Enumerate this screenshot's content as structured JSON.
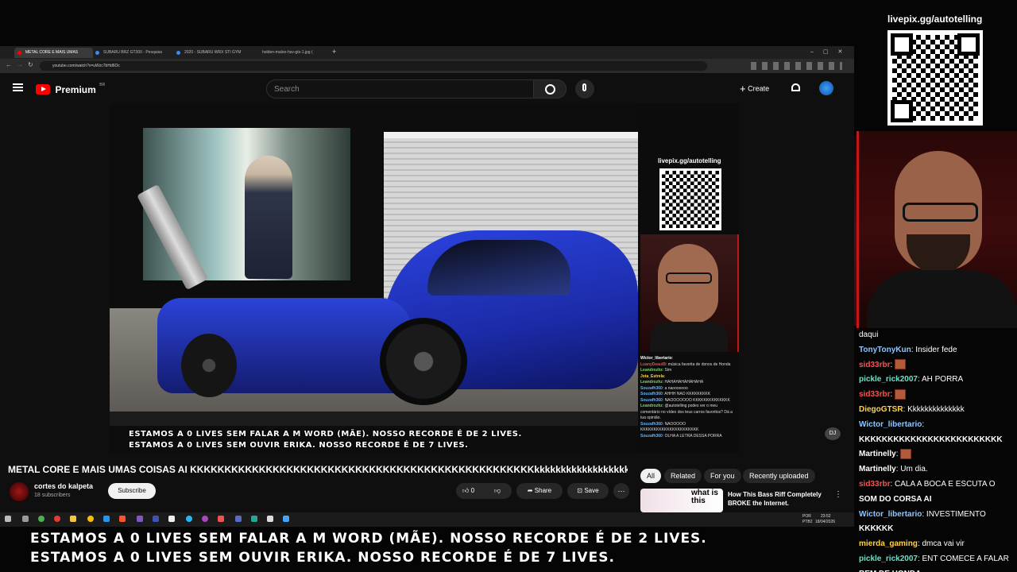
{
  "overlay": {
    "livepix_url": "livepix.gg/autotelling",
    "subtitle_line1": "ESTAMOS A 0 LIVES SEM FALAR A M WORD (MÃE). NOSSO RECORDE É DE 2 LIVES.",
    "subtitle_line2": "ESTAMOS A 0 LIVES SEM OUVIR ERIKA. NOSSO RECORDE É DE 7 LIVES."
  },
  "browser": {
    "tabs": [
      {
        "label": "METAL CORE E MAIS UMAS",
        "color": "#ff0000"
      },
      {
        "label": "SUBARU BRZ GT300 - Pesquisa",
        "color": "#4285f4"
      },
      {
        "label": "2020 - SUBARU WRX STI GYM",
        "color": "#4285f4"
      },
      {
        "label": "holden-maloo-hsv-gts-1.jpg (",
        "color": "#888888"
      }
    ],
    "url": "youtube.com/watch?v=uWzc7bHd6Oc"
  },
  "youtube": {
    "logo": "Premium",
    "region": "BR",
    "search_placeholder": "Search",
    "create_label": "Create",
    "video_title": "METAL CORE E MAIS UMAS COISAS AI KKKKKKKKKKKKKKKKKKKKKKKKKKKKKKKKKKKKKKKKKKKKKKKKKKkkkkkkkkkkkkkkkkkkkkkkk",
    "channel_name": "cortes do kalpeta",
    "subscribers": "18 subscribers",
    "subscribe_label": "Subscribe",
    "like_count": "0",
    "share_label": "Share",
    "save_label": "Save",
    "filter_chips": [
      "All",
      "Related",
      "For you",
      "Recently uploaded"
    ],
    "rec_title_line1": "How This Bass Riff Completely",
    "rec_title_line2": "BROKE the Internet.",
    "rec_thumb_text": "what is this"
  },
  "inner_video": {
    "livepix_url": "livepix.gg/autotelling",
    "chat": [
      {
        "user": "Wictor_libertario",
        "color": "#ffffff",
        "msg": ":"
      },
      {
        "user": "LuanyDeaulB",
        "color": "#ff4444",
        "msg": ": música favorita de donos de Honda"
      },
      {
        "user": "Leandrozhz",
        "color": "#7fd66f",
        "msg": ": Sim"
      },
      {
        "user": "Jota_Estrela",
        "color": "#ffd34a",
        "msg": ":"
      },
      {
        "user": "Leandrozhz",
        "color": "#7fd66f",
        "msg": ": HAHAHAHAHAHAHA"
      },
      {
        "user": "Souzafh360",
        "color": "#66b3ff",
        "msg": ": a naooooooo"
      },
      {
        "user": "Souzafh360",
        "color": "#66b3ff",
        "msg": ": AHHH NAO KKKKKKKKK"
      },
      {
        "user": "Souzafh360",
        "color": "#66b3ff",
        "msg": ": NAOOOOOOO KKKKKKKKKKKKKK"
      },
      {
        "user": "Leandrozhz",
        "color": "#7fd66f",
        "msg": ": @autotelling podes ver o meu comentário no vídeo dos teus carros favoritos? Dá a tua opinião."
      },
      {
        "user": "Souzafh360",
        "color": "#66b3ff",
        "msg": ": NAOOOOO KKKKKKKKKKKKKKKKKKKKKK"
      },
      {
        "user": "Souzafh360",
        "color": "#66b3ff",
        "msg": ": OLHA A LETRA DESSA PORRA"
      }
    ],
    "subtitle_line1": "ESTAMOS A 0 LIVES SEM FALAR A M WORD (MÃE). NOSSO RECORDE É DE 2 LIVES.",
    "subtitle_line2": "ESTAMOS A 0 LIVES SEM OUVIR ERIKA. NOSSO RECORDE É DE 7 LIVES."
  },
  "taskbar": {
    "lang": "POR",
    "lang2": "PTB2",
    "time": "23:52",
    "date": "18/04/2026"
  },
  "chat": [
    {
      "user": "",
      "color": "#ffffff",
      "msg": "daqui",
      "emote": false
    },
    {
      "user": "TonyTonyKun",
      "color": "#8fc6ff",
      "msg": ": Insider fede",
      "emote": false
    },
    {
      "user": "sid33rbr",
      "color": "#ff4f4f",
      "msg": ":",
      "emote": true
    },
    {
      "user": "pickle_rick2007",
      "color": "#6fe0c7",
      "msg": ": AH PORRA",
      "emote": false
    },
    {
      "user": "sid33rbr",
      "color": "#ff4f4f",
      "msg": ":",
      "emote": true
    },
    {
      "user": "DiegoGTSR",
      "color": "#ffd34a",
      "msg": ": Kkkkkkkkkkkkkk",
      "emote": false
    },
    {
      "user": "Wictor_libertario",
      "color": "#8fc6ff",
      "msg": ":",
      "emote": false
    },
    {
      "user": "",
      "color": "#ffffff",
      "msg": "KKKKKKKKKKKKKKKKKKKKKKKKK",
      "emote": false
    },
    {
      "user": "Martinelly",
      "color": "#ffffff",
      "msg": ":",
      "emote": true
    },
    {
      "user": "Martinelly",
      "color": "#ffffff",
      "msg": ": Um dia.",
      "emote": false
    },
    {
      "user": "sid33rbr",
      "color": "#ff4f4f",
      "msg": ": CALA A BOCA E ESCUTA O",
      "emote": false
    },
    {
      "user": "",
      "color": "#ffffff",
      "msg": "SOM DO CORSA AI",
      "emote": false
    },
    {
      "user": "Wictor_libertario",
      "color": "#8fc6ff",
      "msg": ": INVESTIMENTO",
      "emote": false
    },
    {
      "user": "",
      "color": "#ffffff",
      "msg": "KKKKKK",
      "emote": false
    },
    {
      "user": "mierda_gaming",
      "color": "#ffd34a",
      "msg": ": dmca vai vir",
      "emote": false
    },
    {
      "user": "pickle_rick2007",
      "color": "#6fe0c7",
      "msg": ": ENT COMECE A FALAR",
      "emote": false
    },
    {
      "user": "",
      "color": "#ffffff",
      "msg": "BEM DE HONDA",
      "emote": false
    }
  ],
  "colors": {
    "youtube_red": "#ff0000",
    "car_blue": "#2c3fd6",
    "overlay_red": "#c01818"
  }
}
